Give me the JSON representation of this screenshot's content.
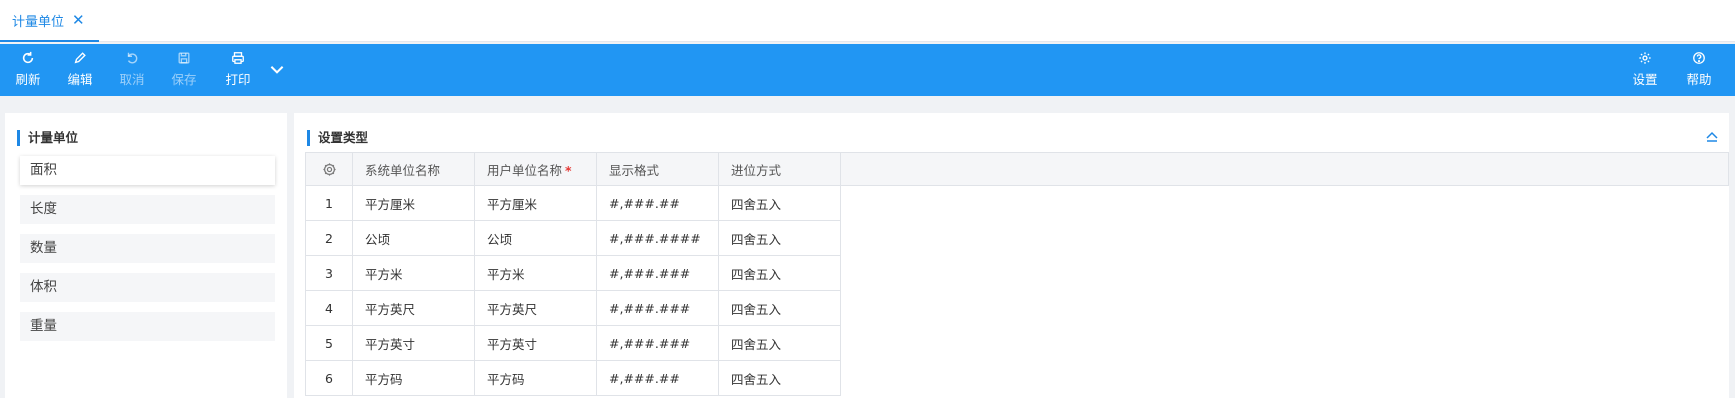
{
  "tab": {
    "label": "计量单位"
  },
  "toolbar": {
    "refresh": "刷新",
    "edit": "编辑",
    "cancel": "取消",
    "save": "保存",
    "print": "打印",
    "settings": "设置",
    "help": "帮助"
  },
  "left_panel": {
    "title": "计量单位",
    "items": [
      {
        "label": "面积"
      },
      {
        "label": "长度"
      },
      {
        "label": "数量"
      },
      {
        "label": "体积"
      },
      {
        "label": "重量"
      }
    ]
  },
  "right_panel": {
    "title": "设置类型",
    "columns": [
      "系统单位名称",
      "用户单位名称",
      "显示格式",
      "进位方式"
    ],
    "required_mark": "*",
    "rows": [
      {
        "no": "1",
        "system": "平方厘米",
        "user": "平方厘米",
        "format": "#,###.##",
        "rounding": "四舍五入"
      },
      {
        "no": "2",
        "system": "公顷",
        "user": "公顷",
        "format": "#,###.####",
        "rounding": "四舍五入"
      },
      {
        "no": "3",
        "system": "平方米",
        "user": "平方米",
        "format": "#,###.###",
        "rounding": "四舍五入"
      },
      {
        "no": "4",
        "system": "平方英尺",
        "user": "平方英尺",
        "format": "#,###.###",
        "rounding": "四舍五入"
      },
      {
        "no": "5",
        "system": "平方英寸",
        "user": "平方英寸",
        "format": "#,###.###",
        "rounding": "四舍五入"
      },
      {
        "no": "6",
        "system": "平方码",
        "user": "平方码",
        "format": "#,###.##",
        "rounding": "四舍五入"
      }
    ]
  },
  "colors": {
    "accent": "#2196f3",
    "tab_active": "#1e88e5",
    "required": "#e53935"
  },
  "icons": {
    "refresh": "refresh-icon",
    "edit": "pencil-icon",
    "cancel": "undo-icon",
    "save": "save-icon",
    "print": "printer-icon",
    "more": "chevron-down-icon",
    "settings": "gear-icon",
    "help": "help-icon",
    "column_settings": "gear-icon",
    "collapse": "chevron-up-icon",
    "close": "close-icon"
  }
}
